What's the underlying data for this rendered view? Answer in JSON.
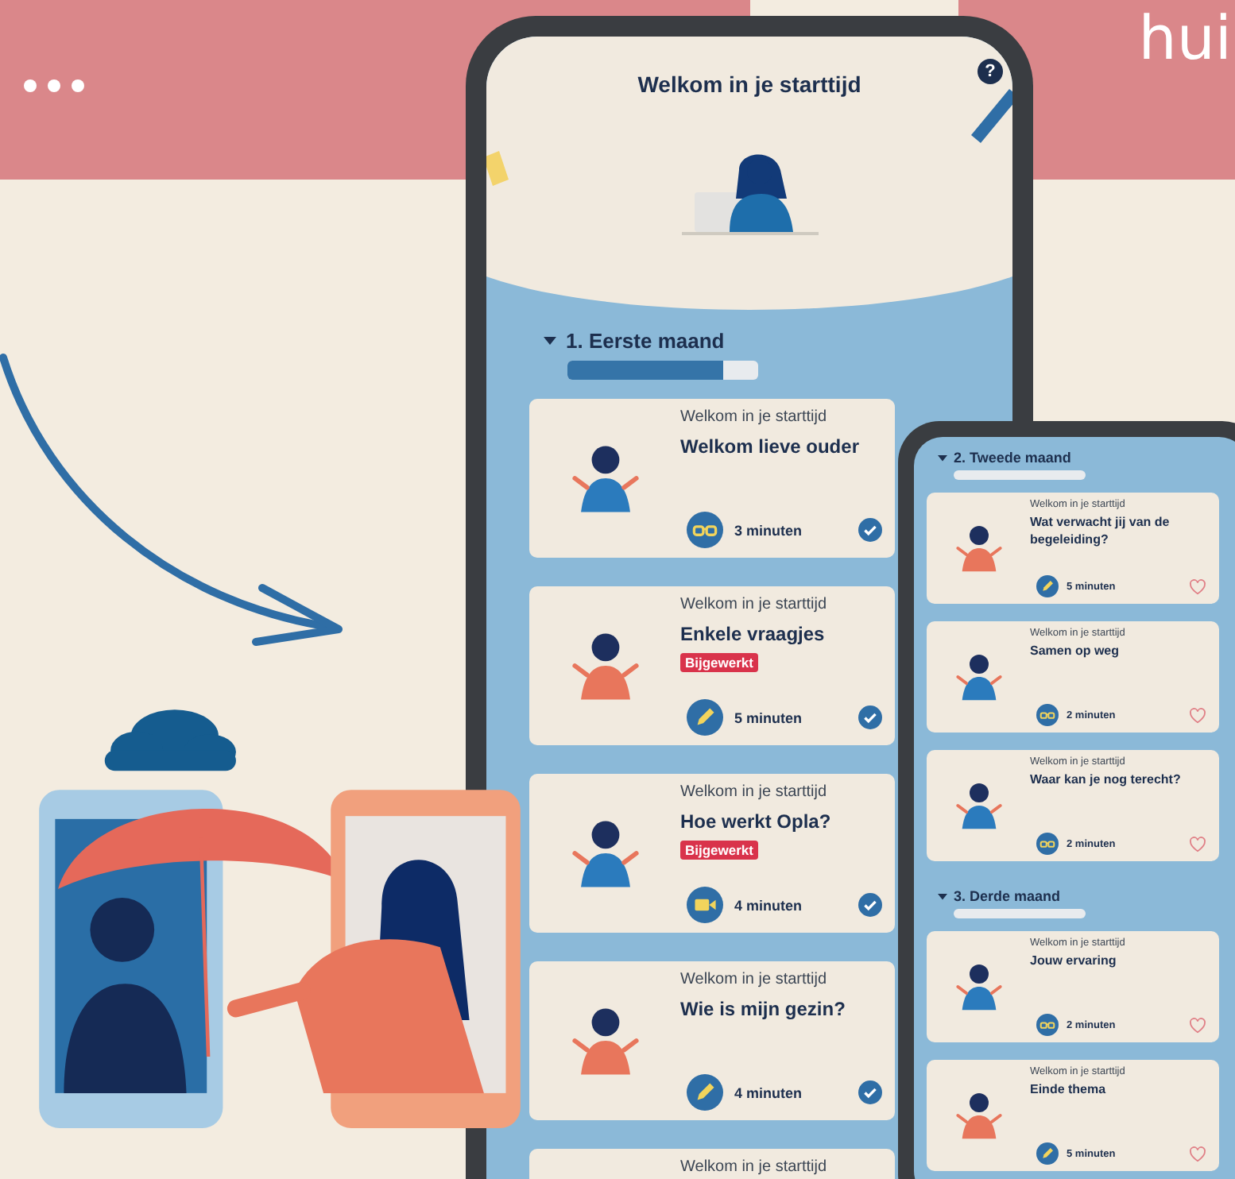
{
  "banner": {
    "text": "hui"
  },
  "main_phone": {
    "title": "Welkom in je starttijd",
    "help": "?",
    "sections": [
      {
        "title": "1. Eerste maand",
        "expanded": true,
        "level": 0.82,
        "cards": [
          {
            "subtitle": "Welkom in je starttijd",
            "title": "Welkom lieve ouder",
            "kind": "read",
            "duration": "3 minuten",
            "completed": true
          },
          {
            "subtitle": "Welkom in je starttijd",
            "title": "Enkele vraagjes",
            "badge": "Bijgewerkt",
            "kind": "write",
            "duration": "5 minuten",
            "completed": true
          },
          {
            "subtitle": "Welkom in je starttijd",
            "title": "Hoe werkt Opla?",
            "badge": "Bijgewerkt",
            "kind": "video",
            "duration": "4 minuten",
            "completed": true
          },
          {
            "subtitle": "Welkom in je starttijd",
            "title": "Wie is mijn gezin?",
            "kind": "write",
            "duration": "4 minuten",
            "completed": true
          },
          {
            "subtitle": "Welkom in je starttijd"
          }
        ]
      }
    ]
  },
  "second_phone": {
    "sections": [
      {
        "title": "2. Tweede maand",
        "expanded": true,
        "level": 0,
        "cards": [
          {
            "subtitle": "Welkom in je starttijd",
            "title": "Wat verwacht jij van de begeleiding?",
            "kind": "write",
            "duration": "5 minuten",
            "completed": false
          },
          {
            "subtitle": "Welkom in je starttijd",
            "title": "Samen op weg",
            "kind": "read",
            "duration": "2 minuten",
            "completed": false
          },
          {
            "subtitle": "Welkom in je starttijd",
            "title": "Waar kan je nog terecht?",
            "kind": "read",
            "duration": "2 minuten",
            "completed": false
          }
        ]
      },
      {
        "title": "3. Derde maand",
        "expanded": true,
        "level": 0,
        "cards": [
          {
            "subtitle": "Welkom in je starttijd",
            "title": "Jouw ervaring",
            "kind": "read",
            "duration": "2 minuten",
            "completed": false
          },
          {
            "subtitle": "Welkom in je starttijd",
            "title": "Einde thema",
            "kind": "write",
            "duration": "5 minuten",
            "completed": false
          }
        ]
      }
    ]
  }
}
